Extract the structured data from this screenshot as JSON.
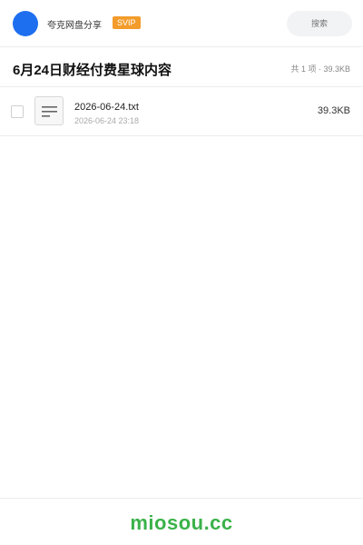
{
  "header": {
    "app_name": "夸克网盘分享",
    "badge": "SVIP",
    "search_placeholder": "搜索"
  },
  "folder": {
    "title": "6月24日财经付费星球内容",
    "summary": "共 1 项 · 39.3KB"
  },
  "files": [
    {
      "name": "2026-06-24.txt",
      "date": "2026-06-24 23:18",
      "size": "39.3KB",
      "icon": "text-file-icon"
    }
  ],
  "footer": {
    "brand": "miosou.cc"
  },
  "colors": {
    "accent": "#1e6ff0",
    "badge": "#f39c2b",
    "brand": "#3bb24a"
  }
}
